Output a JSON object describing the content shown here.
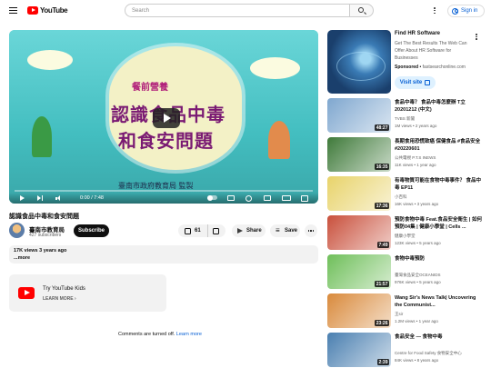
{
  "header": {
    "logo_text": "YouTube",
    "search_placeholder": "Search",
    "signin_label": "Sign in"
  },
  "player": {
    "thumb_top_text": "餐前營養",
    "thumb_main_text_1": "認識食品中毒",
    "thumb_main_text_2": "和食安問題",
    "thumb_credit": "臺南市政府教育局 監製",
    "time_text": "0:00 / 7:48",
    "progress_fraction": 0.0
  },
  "video": {
    "title": "認識食品中毒和食安問題",
    "channel_name": "臺南市教育局",
    "subscribers": "427 subscribers",
    "subscribe_label": "Subscribe",
    "likes": "61",
    "share_label": "Share",
    "save_label": "Save",
    "views_date": "17K views  3 years ago",
    "more_label": "...more"
  },
  "kids_banner": {
    "title": "Try YouTube Kids",
    "learn_more": "LEARN MORE"
  },
  "comments": {
    "off_text": "Comments are turned off.",
    "learn_more": "Learn more"
  },
  "ad": {
    "title": "Find HR Software",
    "description": "Get The Best Results The Web Can Offer About HR Software for Businesses",
    "sponsored": "Sponsored",
    "domain": "fastsearchonline.com",
    "visit_label": "Visit site"
  },
  "recommended": [
    {
      "title": "食品中毒？ 食品中毒怎麼辦 T立 20201212 (中文)",
      "channel": "TVBS 新聞",
      "meta": "1M views • 2 years ago",
      "duration": "48:27",
      "bg": "#7fa7cf"
    },
    {
      "title": "長期食用恐慌致癌 保健食品 #食品安全 #20220601",
      "channel": "公共電視 P.T.S INEWS",
      "meta": "11K views • 1 year ago",
      "duration": "16:35",
      "bg": "#3f7a3a"
    },
    {
      "title": "有毒物質可能在食物中毒事件？ 食品中毒 EP11",
      "channel": "小百科",
      "meta": "16K views • 3 years ago",
      "duration": "17:36",
      "bg": "#e8d36a"
    },
    {
      "title": "預防食物中毒 Feat.食品安全衛生 | 如何預防04集 | 健康小學堂 | Cells ...",
      "channel": "健康小學堂",
      "meta": "123K views • 5 years ago",
      "duration": "7:49",
      "bg": "#c9503c"
    },
    {
      "title": "食物中毒預防",
      "channel": "臺灣食品安全OCEANIDS",
      "meta": "976K views • 5 years ago",
      "duration": "21:57",
      "bg": "#6fbf5a"
    },
    {
      "title": "Wang Sir's News Talk| Uncovering the Communist...",
      "channel": "王sir",
      "meta": "1.2M views • 1 year ago",
      "duration": "23:26",
      "bg": "#d98a3c"
    },
    {
      "title": "食品安全 — 食物中毒",
      "channel": "Centre for Food Safety 食物安全中心",
      "meta": "84K views • 8 years ago",
      "duration": "2:39",
      "bg": "#4a7fb0"
    }
  ]
}
